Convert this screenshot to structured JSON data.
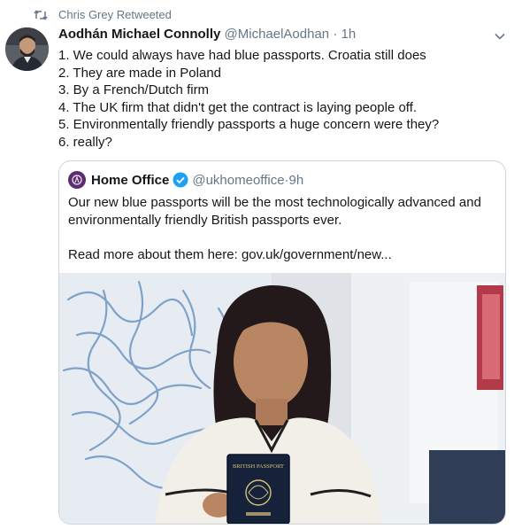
{
  "retweet": {
    "label": "Chris Grey Retweeted"
  },
  "tweet": {
    "author_name": "Aodhán Michael Connolly",
    "handle": "@MichaelAodhan",
    "separator": "·",
    "time": "1h",
    "lines": [
      "1. We could always have had blue passports. Croatia still does",
      "2. They are made in Poland",
      "3. By a French/Dutch firm",
      "4. The UK firm that didn't get the contract is laying people off.",
      "5. Environmentally friendly passports a huge concern were they?",
      "6. really?"
    ]
  },
  "quoted": {
    "author_name": "Home Office",
    "handle": "@ukhomeoffice",
    "separator": "·",
    "time": "9h",
    "lines": [
      "Our new blue passports will be the most technologically advanced and",
      "environmentally friendly British passports ever."
    ],
    "read_more": "Read more about them here: gov.uk/government/new...",
    "passport_label": "BRITISH PASSPORT"
  },
  "icons": {
    "retweet": "retweet-icon",
    "caret": "chevron-down-icon",
    "verified": "verified-badge-icon"
  },
  "colors": {
    "verified": "#1da1f2",
    "muted": "#657786",
    "passport": "#16213a"
  }
}
